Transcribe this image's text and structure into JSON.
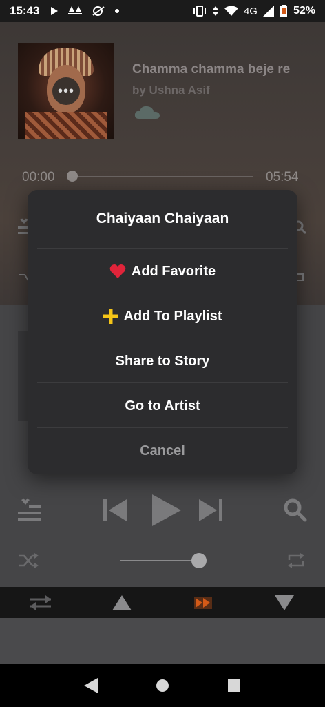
{
  "status_bar": {
    "time": "15:43",
    "network": "4G",
    "battery_pct": "52%"
  },
  "now_playing": {
    "title": "Chamma chamma beje re",
    "artist": "by Ushna Asif",
    "elapsed": "00:00",
    "total": "05:54"
  },
  "dialog": {
    "title": "Chaiyaan Chaiyaan",
    "items": [
      {
        "label": "Add Favorite",
        "icon": "heart-icon"
      },
      {
        "label": "Add To Playlist",
        "icon": "plus-icon"
      },
      {
        "label": "Share to Story"
      },
      {
        "label": "Go to Artist"
      }
    ],
    "cancel_label": "Cancel"
  },
  "volume": {
    "level": 0.92
  },
  "colors": {
    "accent_orange": "#d35a18",
    "heart_red": "#e0243a",
    "plus_yellow": "#f5c518"
  }
}
